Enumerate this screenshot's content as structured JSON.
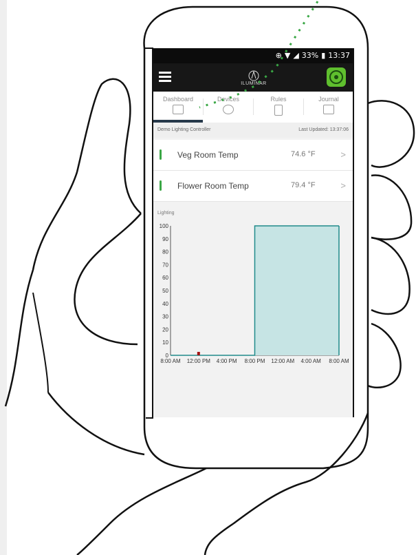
{
  "status_bar": {
    "battery": "33%",
    "time": "13:37"
  },
  "app": {
    "logo_text": "ILUMINAR"
  },
  "tabs": [
    {
      "label": "Dashboard",
      "active": true
    },
    {
      "label": "Devices",
      "active": false
    },
    {
      "label": "Rules",
      "active": false
    },
    {
      "label": "Journal",
      "active": false
    }
  ],
  "controller": {
    "name": "Demo Lighting Controller",
    "last_updated": "Last Updated: 13:37:06"
  },
  "sensors": [
    {
      "name": "Veg Room Temp",
      "value": "74.6 °F",
      "chevron": ">"
    },
    {
      "name": "Flower Room Temp",
      "value": "79.4 °F",
      "chevron": ">"
    }
  ],
  "chart_data": {
    "type": "area",
    "title": "Lighting",
    "xlabel": "",
    "ylabel": "",
    "ylim": [
      0,
      100
    ],
    "yticks": [
      0,
      10,
      20,
      30,
      40,
      50,
      60,
      70,
      80,
      90,
      100
    ],
    "xticks": [
      "8:00 AM",
      "12:00 PM",
      "4:00 PM",
      "8:00 PM",
      "12:00 AM",
      "4:00 AM",
      "8:00 AM"
    ],
    "x": [
      "8:00 AM",
      "12:00 PM",
      "4:00 PM",
      "8:00 PM",
      "8:00 PM",
      "12:00 AM",
      "4:00 AM",
      "8:00 AM"
    ],
    "values": [
      0,
      0,
      0,
      0,
      100,
      100,
      100,
      100
    ],
    "marker_at": "12:00 PM",
    "fill_color": "#c6e4e4",
    "line_color": "#1f8a8a",
    "marker_color": "#a31515"
  }
}
